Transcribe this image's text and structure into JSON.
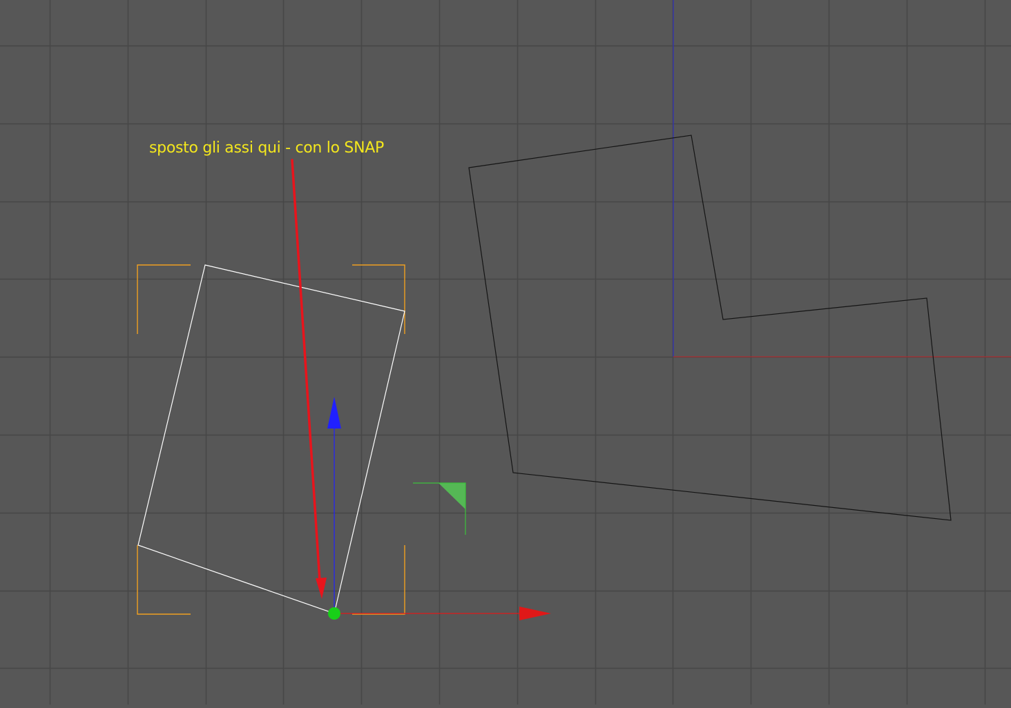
{
  "viewport": {
    "view": "top",
    "background_color": "#575757",
    "grid_color": "#474747",
    "world_x_axis_color": "#c0262a",
    "world_z_axis_color": "#2a2ad0"
  },
  "annotation": {
    "text": "sposto gli assi qui - con lo SNAP",
    "text_color": "#f4e71d",
    "arrow_color": "#e8141c"
  },
  "selected_object": {
    "outline_color": "#ffffff",
    "bounding_box_color": "#f0a020"
  },
  "reference_object": {
    "outline_color": "#141414"
  },
  "gizmo": {
    "x_axis_color": "#e01818",
    "z_axis_color": "#2020ff",
    "plane_handle_color": "#55b855",
    "origin_color": "#18d018",
    "plane_handle_outline": "#3cc23c"
  }
}
